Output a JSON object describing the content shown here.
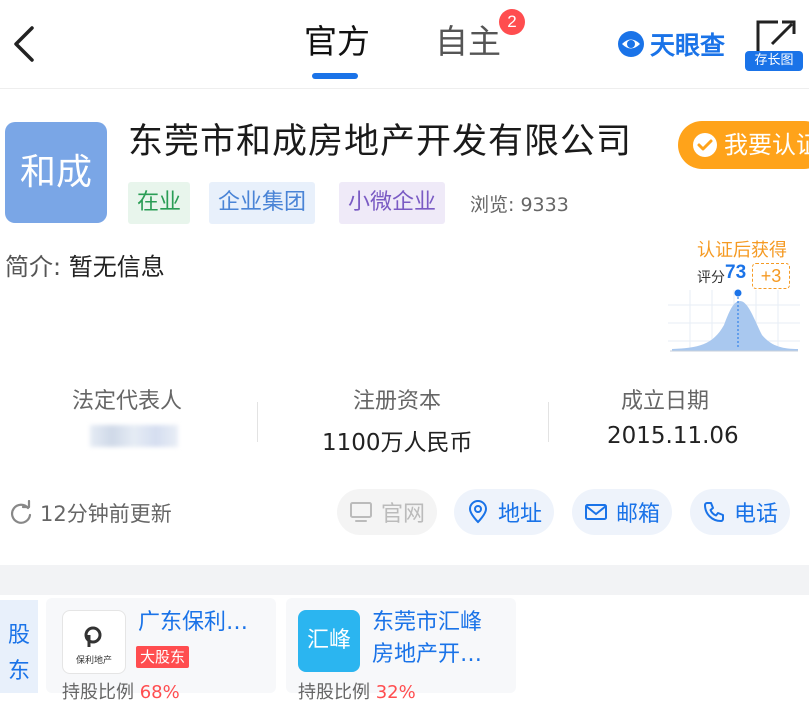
{
  "header": {
    "tabs": [
      {
        "label": "官方",
        "active": true
      },
      {
        "label": "自主",
        "active": false,
        "badge": "2"
      }
    ],
    "brand": "天眼查",
    "share_label": "存长图"
  },
  "company": {
    "logo_text": "和成",
    "name": "东莞市和成房地产开发有限公司",
    "verify_button": "我要认证",
    "tags": [
      "在业",
      "企业集团",
      "小微企业"
    ],
    "views_label": "浏览:",
    "views": "9333",
    "intro_label": "简介:",
    "intro_value": "暂无信息"
  },
  "score": {
    "title": "认证后获得",
    "label": "评分",
    "value": "73",
    "bonus": "+3"
  },
  "stats": [
    {
      "label": "法定代表人",
      "value": ""
    },
    {
      "label": "注册资本",
      "value": "1100万人民币"
    },
    {
      "label": "成立日期",
      "value": "2015.11.06"
    }
  ],
  "update_text": "12分钟前更新",
  "actions": [
    {
      "label": "官网",
      "icon": "monitor-icon",
      "enabled": false
    },
    {
      "label": "地址",
      "icon": "location-icon",
      "enabled": true
    },
    {
      "label": "邮箱",
      "icon": "mail-icon",
      "enabled": true
    },
    {
      "label": "电话",
      "icon": "phone-icon",
      "enabled": true
    }
  ],
  "shareholders": {
    "section_label": "股东",
    "items": [
      {
        "name": "广东保利…",
        "logo_text": "保利地产",
        "tag": "大股东",
        "ratio_label": "持股比例",
        "ratio": "68%"
      },
      {
        "name_line1": "东莞市汇峰",
        "name_line2": "房地产开…",
        "logo_text": "汇峰",
        "ratio_label": "持股比例",
        "ratio": "32%"
      }
    ]
  },
  "colors": {
    "accent": "#1a73e8",
    "verify": "#ffa31a",
    "badge": "#ff4d4f"
  }
}
